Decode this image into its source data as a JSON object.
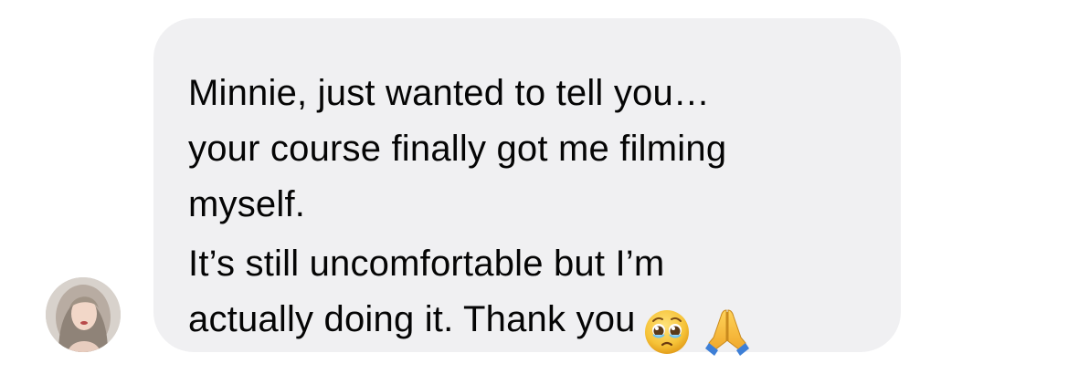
{
  "message": {
    "lines": [
      "Minnie, just wanted to tell you…",
      "your course finally got me filming",
      "myself.",
      "It’s still uncomfortable but I’m",
      "actually doing it. Thank you"
    ],
    "emojis": [
      "pleading-face-icon",
      "folded-hands-icon"
    ]
  },
  "colors": {
    "bubble": "#f0f0f2",
    "text": "#050505"
  }
}
